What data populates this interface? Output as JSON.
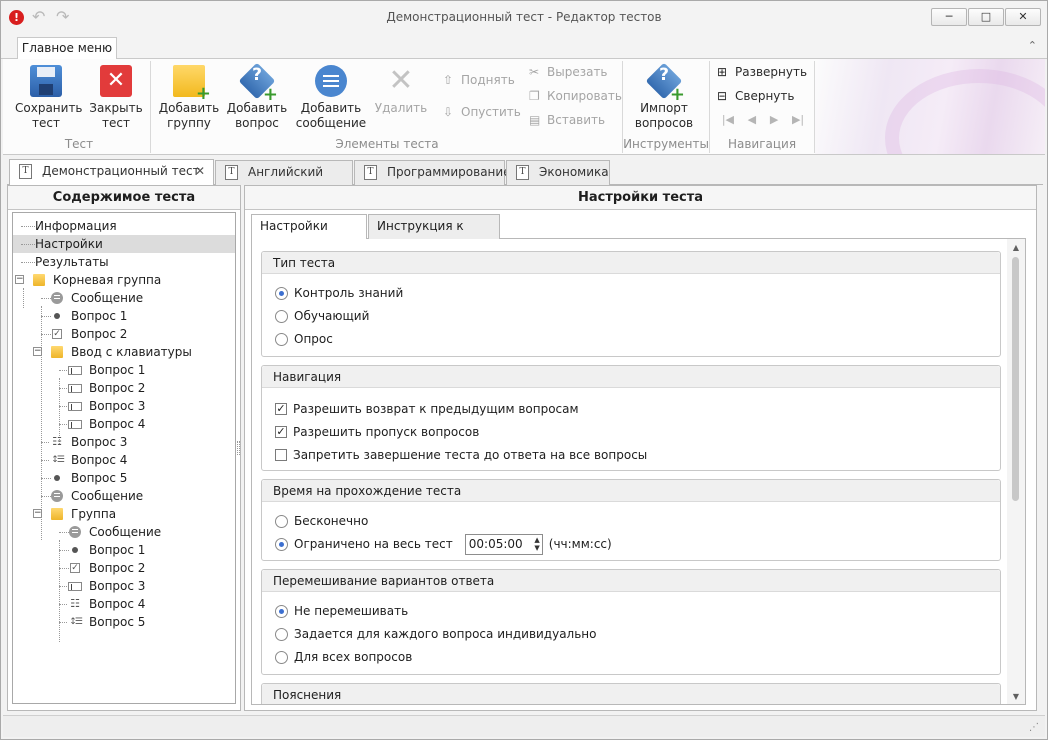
{
  "window": {
    "title": "Демонстрационный тест - Редактор тестов",
    "minimize": "─",
    "maximize": "□",
    "close": "✕"
  },
  "ribbon": {
    "tab": "Главное меню",
    "groups": {
      "test": "Тест",
      "elements": "Элементы теста",
      "tools": "Инструменты",
      "navigation": "Навигация"
    },
    "buttons": {
      "save": [
        "Сохранить",
        "тест"
      ],
      "close": [
        "Закрыть",
        "тест"
      ],
      "add_group": [
        "Добавить",
        "группу"
      ],
      "add_question": [
        "Добавить",
        "вопрос"
      ],
      "add_message": [
        "Добавить",
        "сообщение"
      ],
      "delete": "Удалить",
      "up": "Поднять",
      "down": "Опустить",
      "cut": "Вырезать",
      "copy": "Копировать",
      "paste": "Вставить",
      "import": [
        "Импорт",
        "вопросов"
      ],
      "expand": "Развернуть",
      "collapse": "Свернуть"
    }
  },
  "doc_tabs": [
    {
      "label": "Демонстрационный тест"
    },
    {
      "label": "Английский язык"
    },
    {
      "label": "Программирование"
    },
    {
      "label": "Экономика"
    }
  ],
  "left_panel": {
    "title": "Содержимое теста",
    "tree": [
      "Информация",
      "Настройки",
      "Результаты",
      "Корневая группа",
      "Сообщение",
      "Вопрос 1",
      "Вопрос 2",
      "Ввод с клавиатуры",
      "Вопрос 1",
      "Вопрос 2",
      "Вопрос 3",
      "Вопрос 4",
      "Вопрос 3",
      "Вопрос 4",
      "Вопрос 5",
      "Сообщение",
      "Группа",
      "Сообщение",
      "Вопрос 1",
      "Вопрос 2",
      "Вопрос 3",
      "Вопрос 4",
      "Вопрос 5"
    ]
  },
  "right_panel": {
    "title": "Настройки теста",
    "tabs": [
      "Настройки теста",
      "Инструкция к тесту"
    ],
    "test_type": {
      "header": "Тип теста",
      "options": [
        "Контроль знаний",
        "Обучающий",
        "Опрос"
      ]
    },
    "navigation": {
      "header": "Навигация",
      "options": [
        "Разрешить возврат к предыдущим вопросам",
        "Разрешить пропуск вопросов",
        "Запретить завершение теста до ответа на все вопросы"
      ]
    },
    "time": {
      "header": "Время на прохождение теста",
      "options": [
        "Бесконечно",
        "Ограничено на весь тест"
      ],
      "value": "00:05:00",
      "format": "(чч:мм:сс)"
    },
    "shuffle": {
      "header": "Перемешивание вариантов ответа",
      "options": [
        "Не перемешивать",
        "Задается для каждого вопроса индивидуально",
        "Для всех вопросов"
      ]
    },
    "notes": {
      "header": "Пояснения"
    }
  }
}
